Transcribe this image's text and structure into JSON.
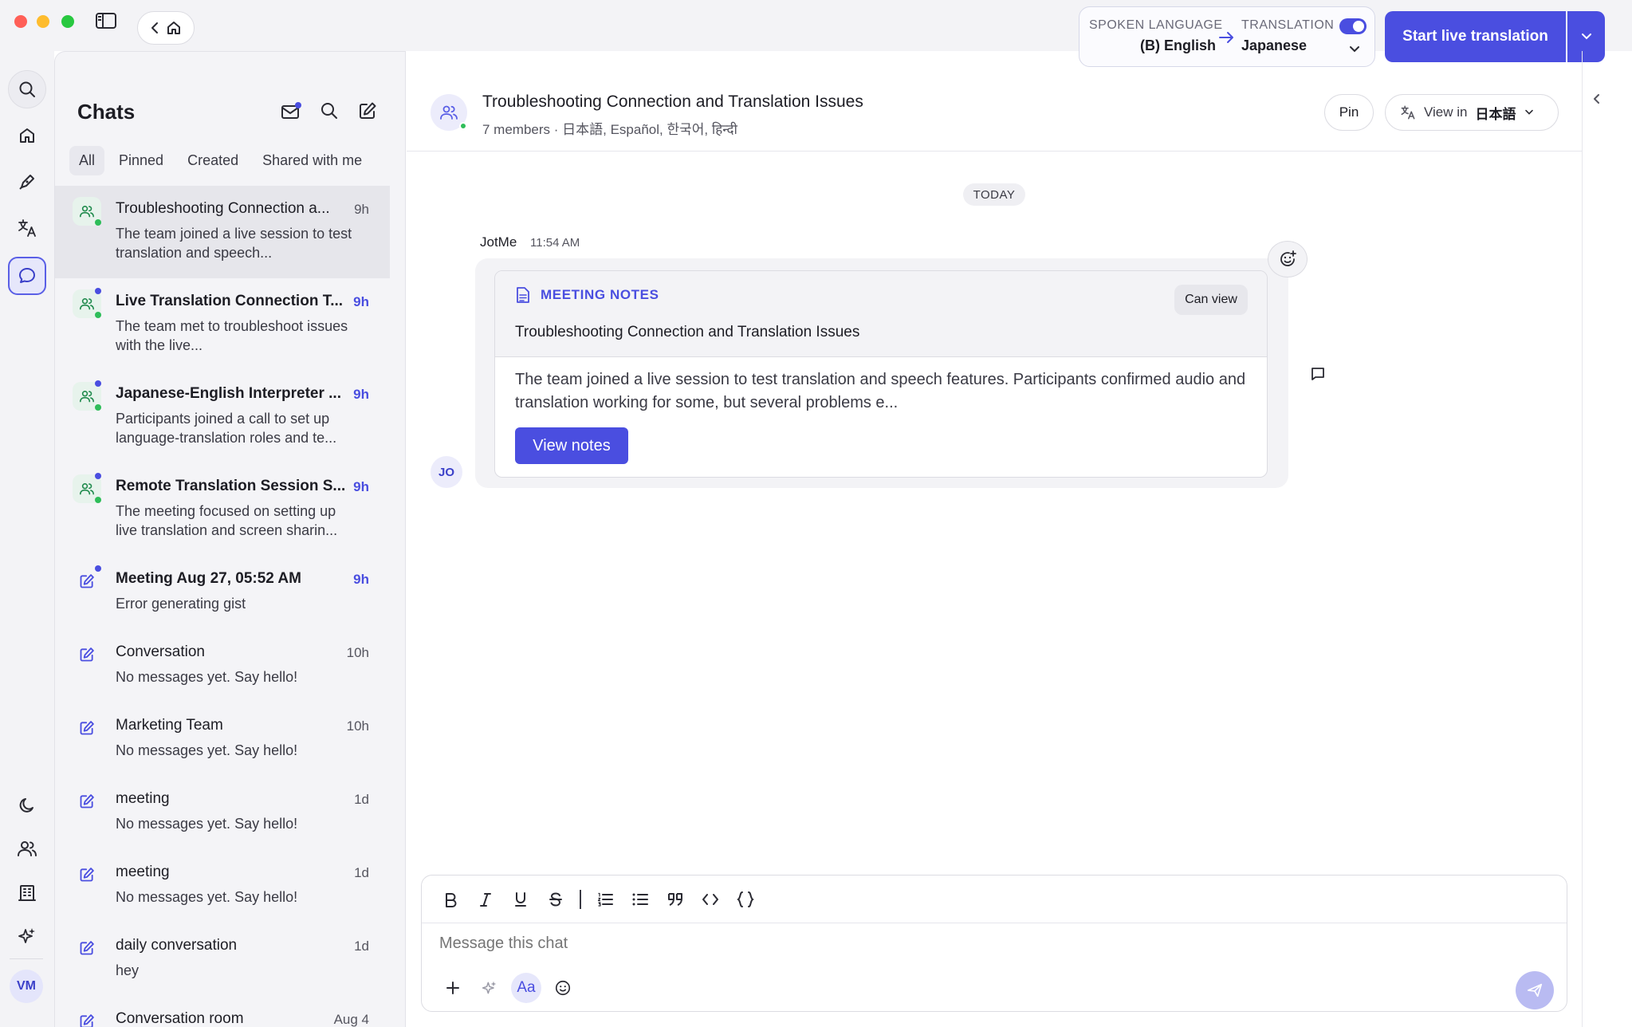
{
  "window": {
    "spoken_caption": "SPOKEN LANGUAGE",
    "spoken_value": "(B) English",
    "translation_caption": "TRANSLATION",
    "translation_value": "Japanese",
    "translation_enabled": true,
    "start_button": "Start live translation",
    "accent_color": "#4a4ee0"
  },
  "rail": {
    "items": [
      "search-icon",
      "home-icon",
      "pen-icon",
      "translate-icon",
      "chat-icon",
      "moon-icon",
      "people-icon",
      "building-icon",
      "sparkle-icon"
    ],
    "avatar_initials": "VM"
  },
  "chats": {
    "title": "Chats",
    "tabs": [
      "All",
      "Pinned",
      "Created",
      "Shared with me"
    ],
    "active_tab": "All",
    "items": [
      {
        "title": "Troubleshooting Connection a...",
        "time": "9h",
        "subtitle": "The team joined a live session to test translation and speech...",
        "type": "group",
        "unread": false
      },
      {
        "title": "Live Translation Connection T...",
        "time": "9h",
        "subtitle": "The team met to troubleshoot issues with the live...",
        "type": "group",
        "unread": true
      },
      {
        "title": "Japanese-English Interpreter ...",
        "time": "9h",
        "subtitle": "Participants joined a call to set up language-translation roles and te...",
        "type": "group",
        "unread": true
      },
      {
        "title": "Remote Translation Session S...",
        "time": "9h",
        "subtitle": "The meeting focused on setting up live translation and screen sharin...",
        "type": "group",
        "unread": true
      },
      {
        "title": "Meeting Aug 27, 05:52 AM",
        "time": "9h",
        "subtitle": "Error generating gist",
        "type": "note",
        "unread": true
      },
      {
        "title": "Conversation",
        "time": "10h",
        "subtitle": "No messages yet. Say hello!",
        "type": "note",
        "unread": false
      },
      {
        "title": "Marketing Team",
        "time": "10h",
        "subtitle": "No messages yet. Say hello!",
        "type": "note",
        "unread": false
      },
      {
        "title": "meeting",
        "time": "1d",
        "subtitle": "No messages yet. Say hello!",
        "type": "note",
        "unread": false
      },
      {
        "title": "meeting",
        "time": "1d",
        "subtitle": "No messages yet. Say hello!",
        "type": "note",
        "unread": false
      },
      {
        "title": "daily conversation",
        "time": "1d",
        "subtitle": "hey",
        "type": "note",
        "unread": false
      },
      {
        "title": "Conversation room",
        "time": "Aug 4",
        "subtitle": "",
        "type": "note",
        "unread": false
      }
    ]
  },
  "room": {
    "title": "Troubleshooting Connection and Translation Issues",
    "subtitle": "7 members · 日本語, Español, 한국어, हिन्दी",
    "pin_label": "Pin",
    "view_in_label": "View in",
    "view_in_language": "日本語"
  },
  "messages": {
    "day_label": "TODAY",
    "sender": "JotMe",
    "time": "11:54 AM",
    "avatar_initials": "JO",
    "card": {
      "label": "MEETING NOTES",
      "permission": "Can view",
      "title": "Troubleshooting Connection and Translation Issues",
      "body": "The team joined a live session to test translation and speech features. Participants confirmed audio and translation working for some, but several problems e...",
      "button": "View notes"
    }
  },
  "composer": {
    "placeholder": "Message this chat",
    "format_tools": [
      "bold",
      "italic",
      "underline",
      "strikethrough",
      "ordered-list",
      "bullet-list",
      "quote",
      "code",
      "code-block"
    ],
    "aa_label": "Aa"
  }
}
